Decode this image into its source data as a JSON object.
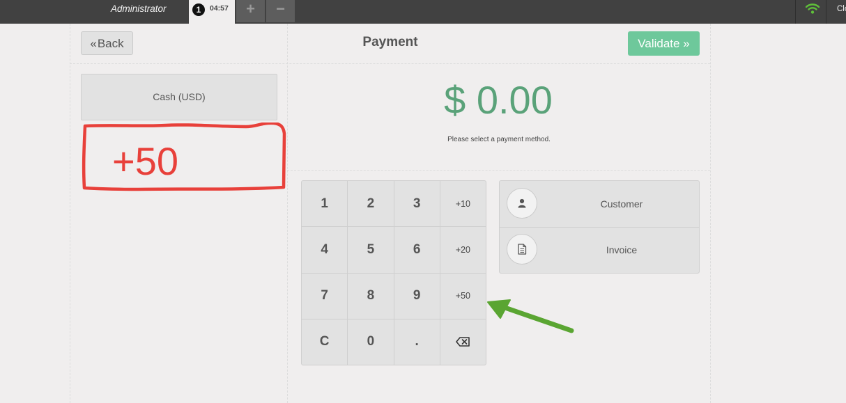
{
  "topbar": {
    "user": "Administrator",
    "order_number": "1",
    "order_time": "04:57",
    "add_icon": "+",
    "remove_icon": "−",
    "close_text": "Clo"
  },
  "header": {
    "back_icon": "«",
    "back_label": "Back",
    "title": "Payment",
    "validate_label": "Validate",
    "validate_icon": "»"
  },
  "payment_methods": [
    "Cash (USD)"
  ],
  "annotation": {
    "text": "+50",
    "color": "#e8403a"
  },
  "amount": "$ 0.00",
  "hint": "Please select a payment method.",
  "numpad": [
    "1",
    "2",
    "3",
    "+10",
    "4",
    "5",
    "6",
    "+20",
    "7",
    "8",
    "9",
    "+50",
    "C",
    "0",
    "."
  ],
  "side": {
    "customer_label": "Customer",
    "customer_icon": "user-icon",
    "invoice_label": "Invoice",
    "invoice_icon": "document-icon"
  },
  "colors": {
    "accent_green": "#6ec89b",
    "amount_green": "#5aa279",
    "topbar": "#414141",
    "arrow_green": "#5aa532"
  }
}
